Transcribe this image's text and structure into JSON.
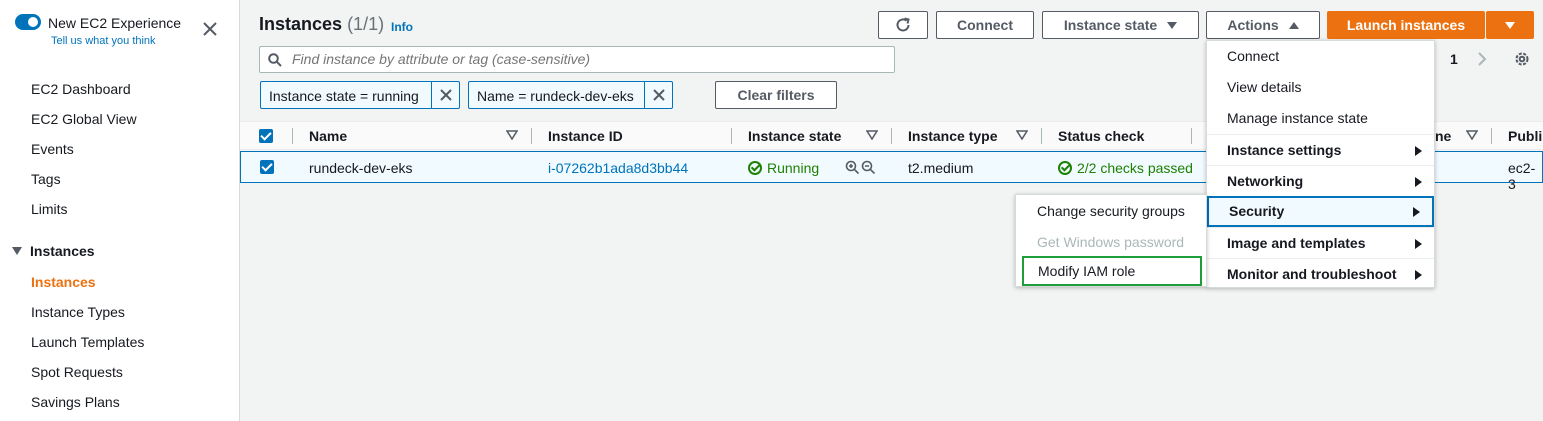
{
  "sidebar": {
    "experience_title": "New EC2 Experience",
    "experience_sub": "Tell us what you think",
    "items": [
      "EC2 Dashboard",
      "EC2 Global View",
      "Events",
      "Tags",
      "Limits"
    ],
    "section": "Instances",
    "section_items": [
      "Instances",
      "Instance Types",
      "Launch Templates",
      "Spot Requests",
      "Savings Plans"
    ]
  },
  "header": {
    "title": "Instances",
    "count": "(1/1)",
    "info": "Info",
    "connect": "Connect",
    "instance_state": "Instance state",
    "actions": "Actions",
    "launch": "Launch instances"
  },
  "search": {
    "placeholder": "Find instance by attribute or tag (case-sensitive)"
  },
  "pager": {
    "page": "1"
  },
  "filters": {
    "tokens": [
      "Instance state = running",
      "Name = rundeck-dev-eks"
    ],
    "clear": "Clear filters"
  },
  "table": {
    "columns": [
      "Name",
      "Instance ID",
      "Instance state",
      "Instance type",
      "Status check",
      "ne",
      "Publi"
    ],
    "row": {
      "name": "rundeck-dev-eks",
      "instance_id": "i-07262b1ada8d3bb44",
      "state": "Running",
      "type": "t2.medium",
      "status": "2/2 checks passed",
      "public": "ec2-3"
    }
  },
  "actions_menu": {
    "items": [
      {
        "label": "Connect"
      },
      {
        "label": "View details"
      },
      {
        "label": "Manage instance state"
      },
      {
        "label": "Instance settings"
      },
      {
        "label": "Networking"
      },
      {
        "label": "Security"
      },
      {
        "label": "Image and templates"
      },
      {
        "label": "Monitor and troubleshoot"
      }
    ]
  },
  "security_menu": {
    "items": [
      {
        "label": "Change security groups"
      },
      {
        "label": "Get Windows password"
      },
      {
        "label": "Modify IAM role"
      }
    ]
  },
  "colors": {
    "accent": "#0073bb",
    "brand_orange": "#ec7211",
    "success": "#1d8102",
    "highlight_box": "#1d9e3a"
  }
}
